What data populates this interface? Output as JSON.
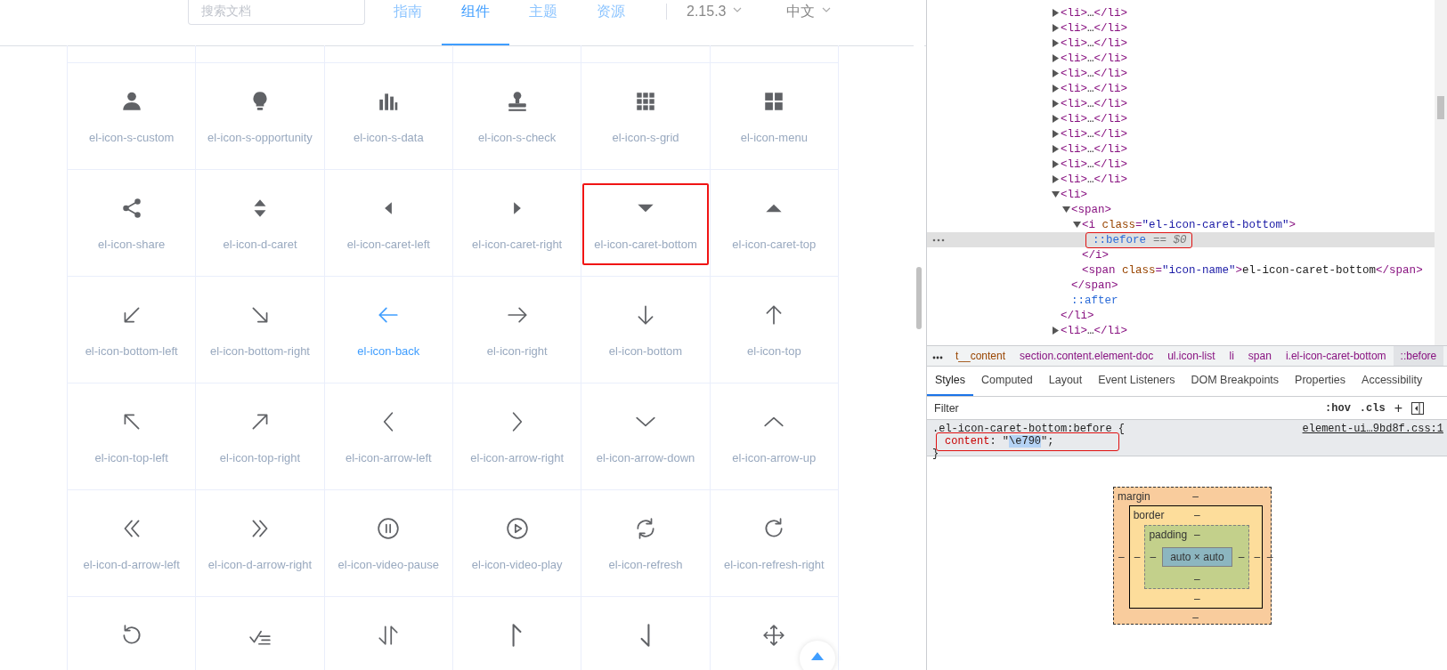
{
  "header": {
    "search": {
      "placeholder": "搜索文档"
    },
    "nav": [
      {
        "label": "指南",
        "selected": false
      },
      {
        "label": "组件",
        "selected": true
      },
      {
        "label": "主题",
        "selected": false
      },
      {
        "label": "资源",
        "selected": false
      }
    ],
    "version": "2.15.3",
    "language": "中文"
  },
  "icons": [
    {
      "kind": "custom",
      "name": "el-icon-s-custom",
      "hovered": false,
      "highlighted": false
    },
    {
      "kind": "opportunity",
      "name": "el-icon-s-opportunity",
      "hovered": false,
      "highlighted": false
    },
    {
      "kind": "data",
      "name": "el-icon-s-data",
      "hovered": false,
      "highlighted": false
    },
    {
      "kind": "check",
      "name": "el-icon-s-check",
      "hovered": false,
      "highlighted": false
    },
    {
      "kind": "grid",
      "name": "el-icon-s-grid",
      "hovered": false,
      "highlighted": false
    },
    {
      "kind": "menu",
      "name": "el-icon-menu",
      "hovered": false,
      "highlighted": false
    },
    {
      "kind": "share",
      "name": "el-icon-share",
      "hovered": false,
      "highlighted": false
    },
    {
      "kind": "dcaret",
      "name": "el-icon-d-caret",
      "hovered": false,
      "highlighted": false
    },
    {
      "kind": "caretleft",
      "name": "el-icon-caret-left",
      "hovered": false,
      "highlighted": false
    },
    {
      "kind": "caretright",
      "name": "el-icon-caret-right",
      "hovered": false,
      "highlighted": false
    },
    {
      "kind": "caretbottom",
      "name": "el-icon-caret-bottom",
      "hovered": false,
      "highlighted": true
    },
    {
      "kind": "carettop",
      "name": "el-icon-caret-top",
      "hovered": false,
      "highlighted": false
    },
    {
      "kind": "bottomleft",
      "name": "el-icon-bottom-left",
      "hovered": false,
      "highlighted": false
    },
    {
      "kind": "bottomright",
      "name": "el-icon-bottom-right",
      "hovered": false,
      "highlighted": false
    },
    {
      "kind": "back",
      "name": "el-icon-back",
      "hovered": true,
      "highlighted": false
    },
    {
      "kind": "right",
      "name": "el-icon-right",
      "hovered": false,
      "highlighted": false
    },
    {
      "kind": "bottom",
      "name": "el-icon-bottom",
      "hovered": false,
      "highlighted": false
    },
    {
      "kind": "top",
      "name": "el-icon-top",
      "hovered": false,
      "highlighted": false
    },
    {
      "kind": "topleft",
      "name": "el-icon-top-left",
      "hovered": false,
      "highlighted": false
    },
    {
      "kind": "topright",
      "name": "el-icon-top-right",
      "hovered": false,
      "highlighted": false
    },
    {
      "kind": "arrowleft",
      "name": "el-icon-arrow-left",
      "hovered": false,
      "highlighted": false
    },
    {
      "kind": "arrowright",
      "name": "el-icon-arrow-right",
      "hovered": false,
      "highlighted": false
    },
    {
      "kind": "arrowdown",
      "name": "el-icon-arrow-down",
      "hovered": false,
      "highlighted": false
    },
    {
      "kind": "arrowup",
      "name": "el-icon-arrow-up",
      "hovered": false,
      "highlighted": false
    },
    {
      "kind": "darrowleft",
      "name": "el-icon-d-arrow-left",
      "hovered": false,
      "highlighted": false
    },
    {
      "kind": "darrowright",
      "name": "el-icon-d-arrow-right",
      "hovered": false,
      "highlighted": false
    },
    {
      "kind": "videopause",
      "name": "el-icon-video-pause",
      "hovered": false,
      "highlighted": false
    },
    {
      "kind": "videoplay",
      "name": "el-icon-video-play",
      "hovered": false,
      "highlighted": false
    },
    {
      "kind": "refresh",
      "name": "el-icon-refresh",
      "hovered": false,
      "highlighted": false
    },
    {
      "kind": "refreshright",
      "name": "el-icon-refresh-right",
      "hovered": false,
      "highlighted": false
    },
    {
      "kind": "refreshleft",
      "hovered": false,
      "highlighted": false
    },
    {
      "kind": "finished",
      "hovered": false,
      "highlighted": false
    },
    {
      "kind": "sort",
      "hovered": false,
      "highlighted": false
    },
    {
      "kind": "sortup",
      "hovered": false,
      "highlighted": false
    },
    {
      "kind": "sortdown",
      "hovered": false,
      "highlighted": false
    },
    {
      "kind": "rank",
      "hovered": false,
      "highlighted": false
    }
  ],
  "devtools": {
    "dom_tree": [
      {
        "text": "<li>…</li>",
        "expanded": false,
        "selected": false
      },
      {
        "text": "<li>…</li>",
        "expanded": false,
        "selected": false
      },
      {
        "text": "<li>…</li>",
        "expanded": false,
        "selected": false
      },
      {
        "text": "<li>…</li>",
        "expanded": false,
        "selected": false
      },
      {
        "text": "<li>…</li>",
        "expanded": false,
        "selected": false
      },
      {
        "text": "<li>…</li>",
        "expanded": false,
        "selected": false
      },
      {
        "text": "<li>…</li>",
        "expanded": false,
        "selected": false
      },
      {
        "text": "<li>…</li>",
        "expanded": false,
        "selected": false
      },
      {
        "text": "<li>…</li>",
        "expanded": false,
        "selected": false
      },
      {
        "text": "<li>…</li>",
        "expanded": false,
        "selected": false
      },
      {
        "text": "<li>…</li>",
        "expanded": false,
        "selected": false
      },
      {
        "text": "<li>…</li>",
        "expanded": false,
        "selected": false
      },
      {
        "text": "<li>",
        "expanded": true,
        "selected": false,
        "children": [
          {
            "text": "<span>",
            "expanded": true,
            "selected": false,
            "children": [
              {
                "text": "<i class=\"el-icon-caret-bottom\">",
                "expanded": true,
                "selected": false,
                "children": [
                  {
                    "text": "::before",
                    "kind": "pseudo",
                    "note": "== $0",
                    "selected": true,
                    "annotated": true
                  }
                ]
              },
              {
                "text": "</i>",
                "selected": false
              },
              {
                "text": "<span class=\"icon-name\">el-icon-caret-bottom</span>",
                "selected": false
              }
            ]
          },
          {
            "text": "</span>",
            "selected": false
          },
          {
            "text": "::after",
            "kind": "pseudo",
            "selected": false
          }
        ]
      },
      {
        "text": "</li>",
        "selected": false
      },
      {
        "text": "<li>…</li>",
        "expanded": false,
        "selected": false
      }
    ],
    "breadcrumbs": [
      {
        "label": "t__content",
        "kind": "class",
        "selected": false
      },
      {
        "label": "section.content.element-doc",
        "kind": "tag",
        "selected": false
      },
      {
        "label": "ul.icon-list",
        "kind": "tag",
        "selected": false
      },
      {
        "label": "li",
        "kind": "tag",
        "selected": false
      },
      {
        "label": "span",
        "kind": "tag",
        "selected": false
      },
      {
        "label": "i.el-icon-caret-bottom",
        "kind": "tag",
        "selected": false
      },
      {
        "label": "::before",
        "kind": "tag",
        "selected": true
      }
    ],
    "tabs": [
      {
        "label": "Styles",
        "selected": true
      },
      {
        "label": "Computed",
        "selected": false
      },
      {
        "label": "Layout",
        "selected": false
      },
      {
        "label": "Event Listeners",
        "selected": false
      },
      {
        "label": "DOM Breakpoints",
        "selected": false
      },
      {
        "label": "Properties",
        "selected": false
      },
      {
        "label": "Accessibility",
        "selected": false
      }
    ],
    "filter": {
      "placeholder": "Filter"
    },
    "toolbar": [
      ":hov",
      ".cls",
      "+"
    ],
    "rule": {
      "selector": ".el-icon-caret-bottom:before {",
      "source": "element-ui…9bd8f.css:1",
      "property": "content",
      "separator": ": ",
      "value_parts": [
        {
          "text": "\"",
          "selected": false
        },
        {
          "text": "\\e790",
          "selected": true
        },
        {
          "text": "\";",
          "selected": false
        }
      ],
      "annotated": true,
      "close": "}"
    },
    "box_model": {
      "margin": {
        "label": "margin",
        "top": "–",
        "right": "–",
        "bottom": "–",
        "left": "–"
      },
      "border": {
        "label": "border",
        "top": "–",
        "right": "–",
        "bottom": "–",
        "left": "–"
      },
      "padding": {
        "label": "padding",
        "top": "–",
        "right": "–",
        "bottom": "–",
        "left": "–"
      },
      "content": "auto × auto"
    }
  }
}
